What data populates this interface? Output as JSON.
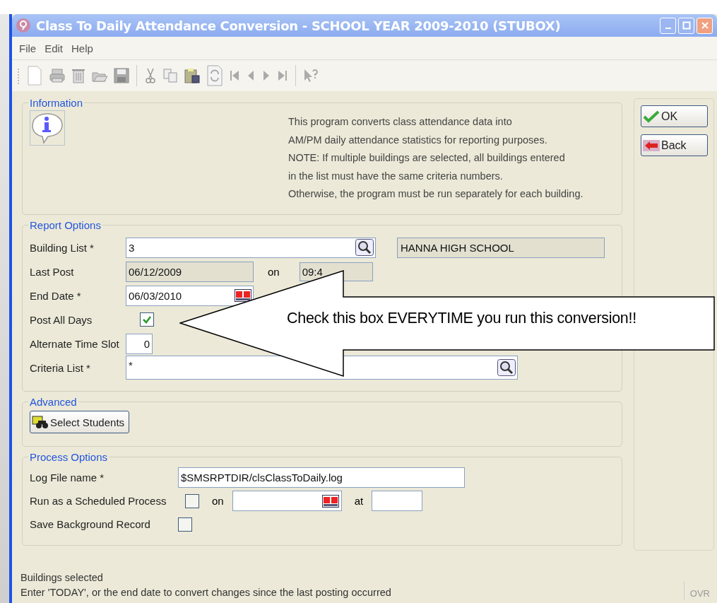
{
  "window": {
    "title": "Class To Daily Attendance Conversion - SCHOOL YEAR 2009-2010  (STUBOX)"
  },
  "menu": [
    "File",
    "Edit",
    "Help"
  ],
  "information": {
    "title": "Information",
    "lines": [
      "This program converts class attendance data into",
      "AM/PM daily attendance statistics for reporting purposes.",
      "NOTE: If multiple buildings are selected, all buildings entered",
      "in the list must have the same criteria numbers.",
      "Otherwise, the program must be run separately for each building."
    ]
  },
  "report_options": {
    "title": "Report Options",
    "building_list": {
      "label": "Building List *",
      "value": "3",
      "name": "HANNA HIGH SCHOOL"
    },
    "last_post": {
      "label": "Last Post",
      "date": "06/12/2009",
      "on_label": "on",
      "time": "09:4"
    },
    "end_date": {
      "label": "End Date *",
      "value": "06/03/2010"
    },
    "post_all_days": {
      "label": "Post All Days",
      "checked": true
    },
    "alternate_time_slot": {
      "label": "Alternate Time Slot",
      "value": "0"
    },
    "criteria_list": {
      "label": "Criteria List *",
      "value": "*"
    }
  },
  "advanced": {
    "title": "Advanced",
    "button": "Select Students"
  },
  "process_options": {
    "title": "Process Options",
    "log_file": {
      "label": "Log File name *",
      "value": "$SMSRPTDIR/clsClassToDaily.log"
    },
    "scheduled": {
      "label": "Run as a Scheduled Process",
      "checked": false,
      "on_label": "on",
      "at_label": "at"
    },
    "save_background": {
      "label": "Save Background Record",
      "checked": false
    }
  },
  "buttons": [
    {
      "kind": "ok",
      "label": "OK"
    },
    {
      "kind": "back",
      "label": "Back"
    }
  ],
  "status_bar": {
    "lines": [
      "Buildings selected",
      "Enter 'TODAY', or the end date to convert changes since the last posting occurred"
    ],
    "mode": "OVR"
  },
  "callout": {
    "text": "Check this box EVERYTIME you run this conversion!!"
  }
}
